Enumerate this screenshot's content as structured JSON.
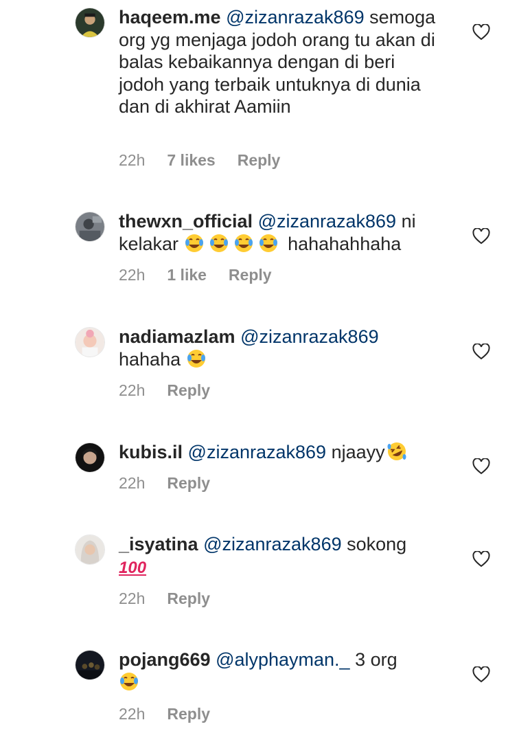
{
  "comments": [
    {
      "username": "haqeem.me",
      "mention": "@zizanrazak869",
      "text": "semoga org yg menjaga jodoh orang tu akan di balas kebaikannya dengan di beri jodoh yang terbaik untuknya di dunia dan di akhirat Aamiin",
      "time": "22h",
      "likes": "7 likes",
      "reply": "Reply"
    },
    {
      "username": "thewxn_official",
      "mention": "@zizanrazak869",
      "text_before": "ni kelakar",
      "emojis": [
        "tears-of-joy",
        "tears-of-joy",
        "tears-of-joy",
        "tears-of-joy"
      ],
      "text_after": "hahahahhaha",
      "time": "22h",
      "likes": "1 like",
      "reply": "Reply"
    },
    {
      "username": "nadiamazlam",
      "mention": "@zizanrazak869",
      "text_before": "hahaha",
      "emojis": [
        "tears-of-joy"
      ],
      "time": "22h",
      "reply": "Reply"
    },
    {
      "username": "kubis.il",
      "mention": "@zizanrazak869",
      "text_before": "njaayy",
      "emojis": [
        "rolling-on-floor-laughing"
      ],
      "time": "22h",
      "reply": "Reply"
    },
    {
      "username": "_isyatina",
      "mention": "@zizanrazak869",
      "text_before": "sokong",
      "emoji_text": "100",
      "time": "22h",
      "reply": "Reply"
    },
    {
      "username": "pojang669",
      "mention": "@alyphayman._",
      "text_before": "3 org",
      "emojis": [
        "tears-of-joy"
      ],
      "time": "22h",
      "reply": "Reply"
    }
  ],
  "icons": {
    "like": "heart-outline-icon",
    "laugh": "tears-of-joy-emoji",
    "rofl": "rolling-on-floor-laughing-emoji",
    "hundred": "hundred-points-emoji"
  },
  "colors": {
    "text": "#262626",
    "mention": "#003569",
    "meta": "#8e8e8e",
    "hundred": "#e0245e"
  }
}
